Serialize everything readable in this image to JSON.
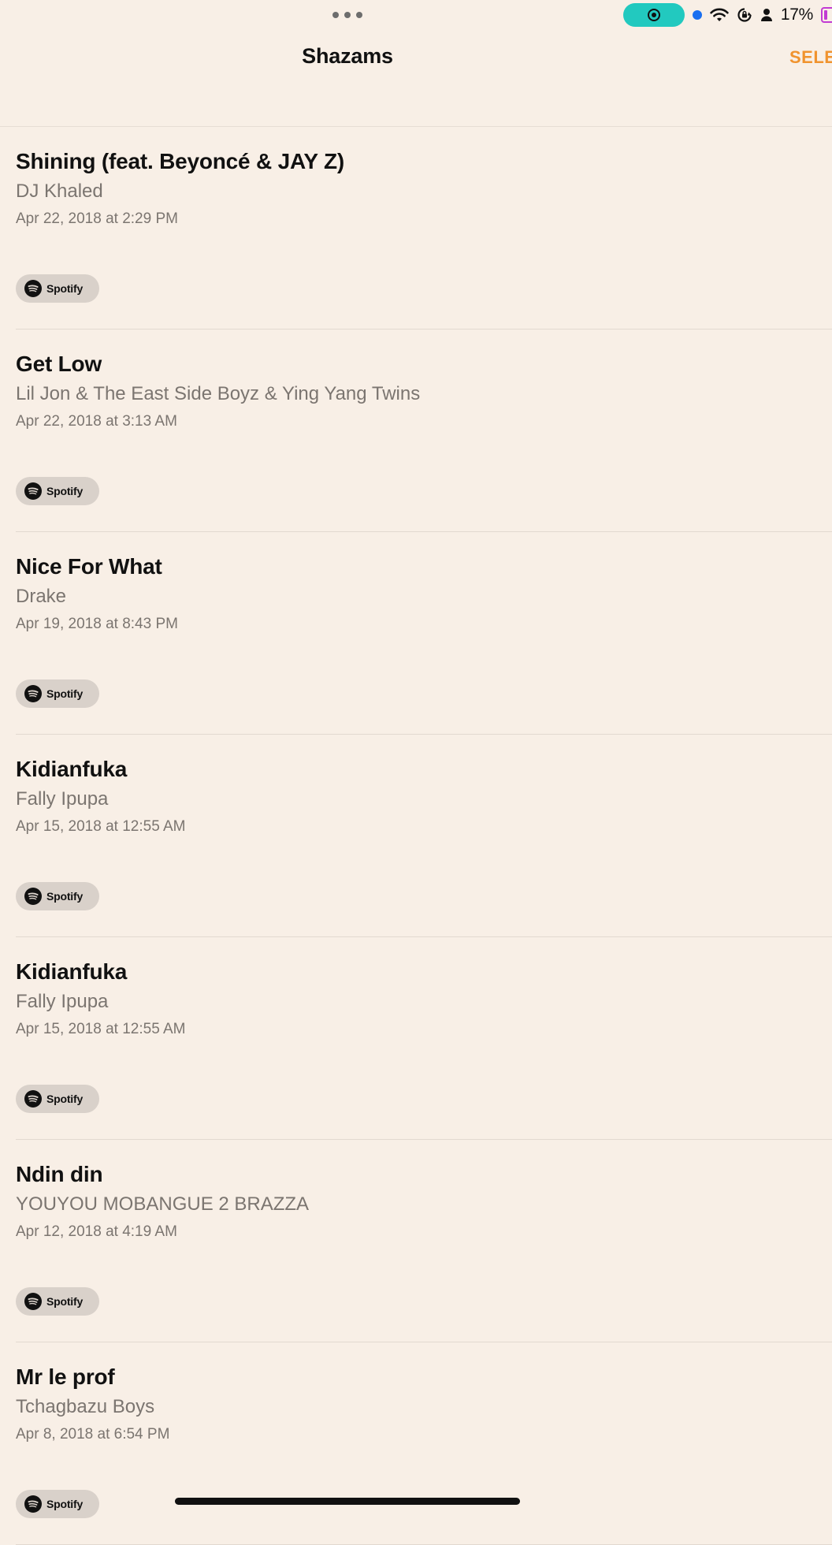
{
  "status_bar": {
    "battery_percent": "17%",
    "record_color": "#22c9bf",
    "battery_color": "#c23bd3"
  },
  "nav": {
    "title": "Shazams",
    "select_label": "SELE",
    "accent_color": "#f0932e"
  },
  "shazams": [
    {
      "title": "Shining (feat. Beyoncé & JAY Z)",
      "artist": "DJ Khaled",
      "date": "Apr 22, 2018 at 2:29 PM",
      "provider": "Spotify"
    },
    {
      "title": "Get Low",
      "artist": "Lil Jon & The East Side Boyz & Ying Yang Twins",
      "date": "Apr 22, 2018 at 3:13 AM",
      "provider": "Spotify"
    },
    {
      "title": "Nice For What",
      "artist": "Drake",
      "date": "Apr 19, 2018 at 8:43 PM",
      "provider": "Spotify"
    },
    {
      "title": "Kidianfuka",
      "artist": "Fally Ipupa",
      "date": "Apr 15, 2018 at 12:55 AM",
      "provider": "Spotify"
    },
    {
      "title": "Kidianfuka",
      "artist": "Fally Ipupa",
      "date": "Apr 15, 2018 at 12:55 AM",
      "provider": "Spotify"
    },
    {
      "title": "Ndin din",
      "artist": "YOUYOU MOBANGUE 2 BRAZZA",
      "date": "Apr 12, 2018 at 4:19 AM",
      "provider": "Spotify"
    },
    {
      "title": "Mr le prof",
      "artist": "Tchagbazu Boys",
      "date": "Apr 8, 2018 at 6:54 PM",
      "provider": "Spotify"
    }
  ],
  "icons": {
    "more": "more-dots-icon",
    "record": "screen-record-icon",
    "wifi": "wifi-icon",
    "rotation_lock": "rotation-lock-icon",
    "person": "person-icon",
    "battery": "battery-icon",
    "spotify": "spotify-icon"
  }
}
